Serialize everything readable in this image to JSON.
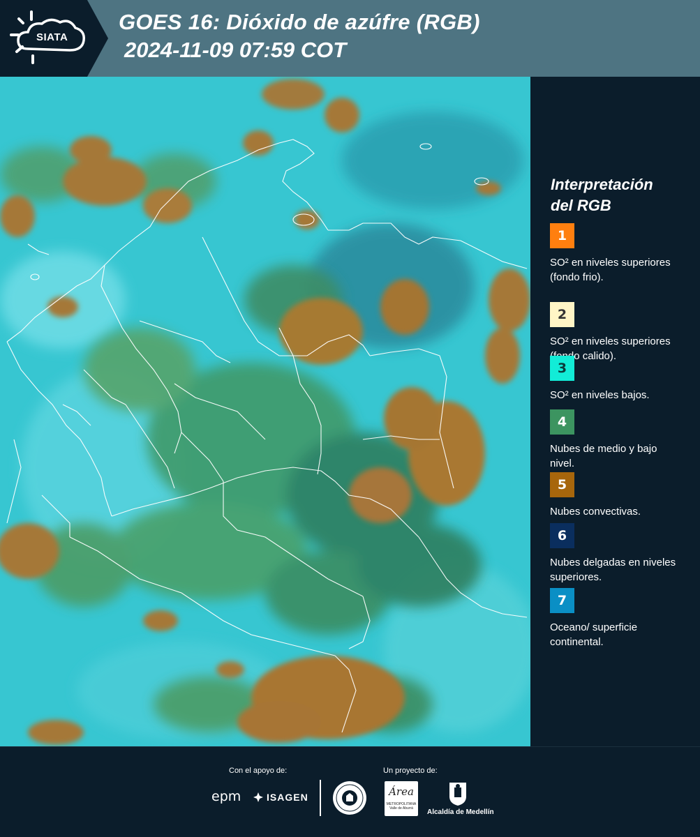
{
  "header": {
    "logo_text": "SIATA",
    "title": "GOES 16: Dióxido de azúfre (RGB)",
    "datetime": "2024-11-09 07:59 COT"
  },
  "legend": {
    "title_line1": "Interpretación",
    "title_line2": "del RGB",
    "items": [
      {
        "number": "1",
        "color": "#ff7f0f",
        "number_color": "#ffffff",
        "text": "SO² en niveles superiores (fondo frio)."
      },
      {
        "number": "2",
        "color": "#fff5c6",
        "number_color": "#333333",
        "text": "SO² en niveles superiores (fondo calido)."
      },
      {
        "number": "3",
        "color": "#12ecd7",
        "number_color": "#0b3b3b",
        "text": "SO² en niveles bajos."
      },
      {
        "number": "4",
        "color": "#3c9460",
        "number_color": "#ffffff",
        "text": "Nubes de medio y bajo nivel."
      },
      {
        "number": "5",
        "color": "#a7660c",
        "number_color": "#ffffff",
        "text": "Nubes convectivas."
      },
      {
        "number": "6",
        "color": "#0a2e5e",
        "number_color": "#ffffff",
        "text": "Nubes delgadas en niveles superiores."
      },
      {
        "number": "7",
        "color": "#0a8fc5",
        "number_color": "#ffffff",
        "text": "Oceano/ superficie continental."
      }
    ]
  },
  "footer": {
    "support_label": "Con el apoyo de:",
    "project_label": "Un proyecto de:",
    "sponsor_epm": "epm",
    "sponsor_isagen": "ISAGEN",
    "area_logo_text": "Área",
    "area_logo_subtext": "METROPOLITANA Valle de Aburrá",
    "alcaldia_text": "Alcaldía de Medellín"
  },
  "colors": {
    "header_bg": "#4e7482",
    "panel_bg": "#0b1d2b",
    "map_cyan": "#37c6d1",
    "map_green": "#3d8a63",
    "map_convective": "#a8752c",
    "boundary_lines": "#ffffff"
  }
}
